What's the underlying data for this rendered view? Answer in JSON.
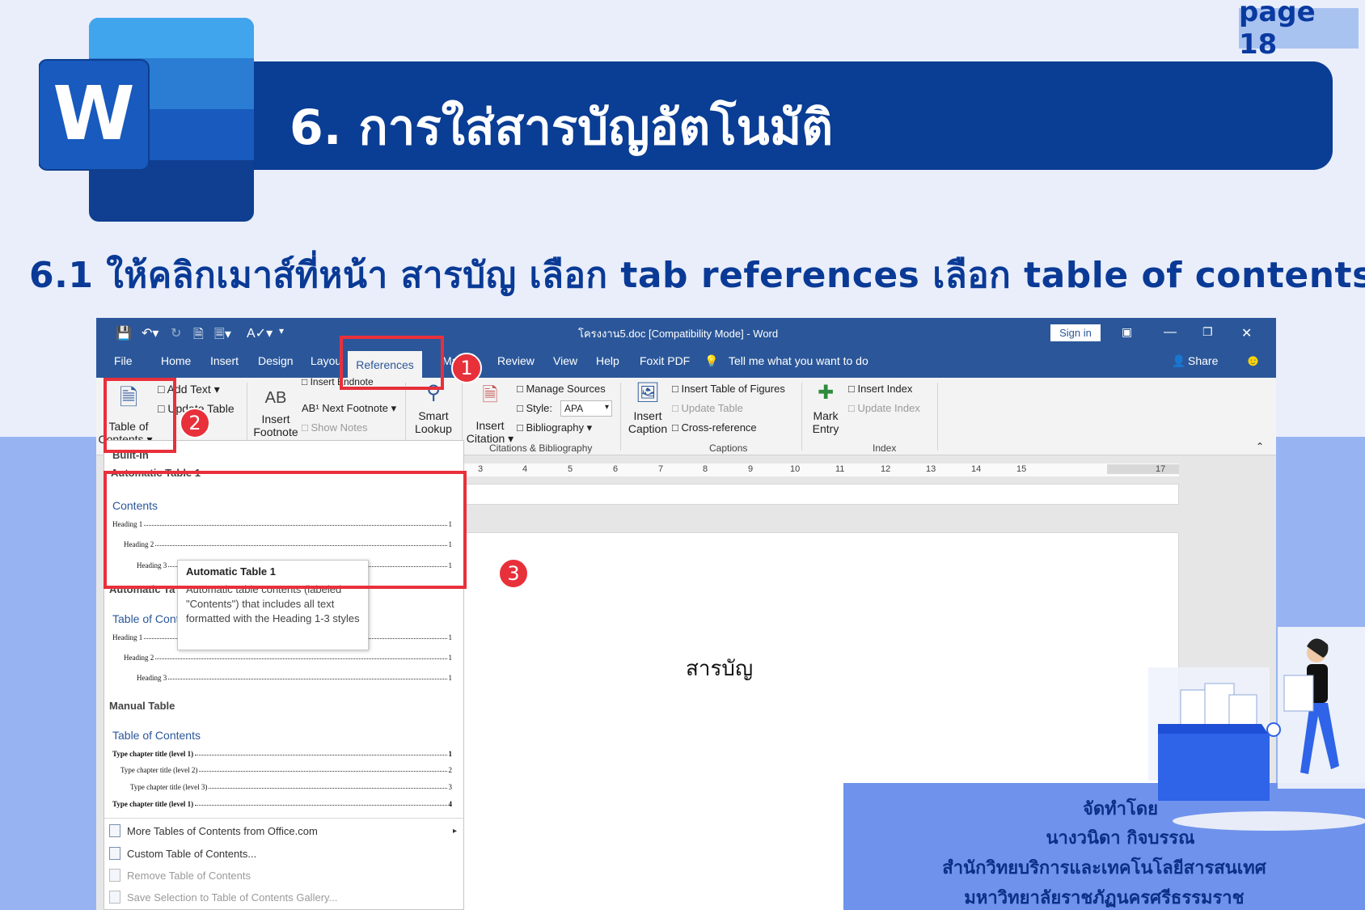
{
  "slide": {
    "page_tag": "page 18",
    "title": "6.   การใส่สารบัญอัตโนมัติ",
    "subtitle": "6.1 ให้คลิกเมาส์ที่หน้า สารบัญ เลือก tab references เลือก table of contents",
    "credit": {
      "line1": "จัดทำโดย",
      "line2": "นางวนิดา กิจบรรณ",
      "line3": "สำนักวิทยบริการและเทคโนโลยีสารสนเทศ",
      "line4": "มหาวิทยาลัยราชภัฏนครศรีธรรมราช"
    },
    "logo_letter": "W"
  },
  "word": {
    "window_title": "โครงงาน5.doc [Compatibility Mode]  -  Word",
    "sign_in": "Sign in",
    "tabs": [
      "File",
      "Home",
      "Insert",
      "Design",
      "Layou",
      "References",
      "Ma",
      "Review",
      "View",
      "Help",
      "Foxit PDF"
    ],
    "active_tab": "References",
    "tell_me": "Tell me what you want to do",
    "share": "Share",
    "ribbon": {
      "toc_button": "Table of",
      "toc_button2": "Contents",
      "add_text": "Add Text",
      "update_table": "Update Table",
      "insert_endnote": "Insert Endnote",
      "insert_footnote": "Insert",
      "insert_footnote2": "Footnote",
      "ab_label": "AB",
      "next_footnote": "Next Footnote",
      "show_notes": "Show Notes",
      "smart_lookup": "Smart",
      "smart_lookup2": "Lookup",
      "research": "arch",
      "insert_citation": "Insert",
      "insert_citation2": "Citation",
      "manage_sources": "Manage Sources",
      "style_label": "Style:",
      "style_value": "APA",
      "bibliography": "Bibliography",
      "group_citations": "Citations & Bibliography",
      "insert_caption": "Insert",
      "insert_caption2": "Caption",
      "insert_table_figures": "Insert Table of Figures",
      "update_table2": "Update Table",
      "cross_reference": "Cross-reference",
      "group_captions": "Captions",
      "mark_entry": "Mark",
      "mark_entry2": "Entry",
      "insert_index": "Insert Index",
      "update_index": "Update Index",
      "group_index": "Index"
    },
    "ruler_ticks": [
      "3",
      "4",
      "5",
      "6",
      "7",
      "8",
      "9",
      "10",
      "11",
      "12",
      "13",
      "14",
      "15",
      "17"
    ],
    "document_text": "สารบัญ"
  },
  "dropdown": {
    "builtin": "Built-In",
    "auto1_header": "Automatic Table 1",
    "auto1_title": "Contents",
    "heading1": "Heading 1",
    "heading2": "Heading 2",
    "heading3": "Heading 3",
    "page_no": "1",
    "auto2_header": "Automatic Ta",
    "auto2_title": "Table of Cont",
    "manual_header": "Manual Table",
    "manual_title": "Table of Contents",
    "manual_l1": "Type chapter title (level 1)",
    "manual_l2": "Type chapter title (level 2)",
    "manual_l3": "Type chapter title (level 3)",
    "manual_l1b": "Type chapter title (level 1)",
    "manual_p1": "1",
    "manual_p2": "2",
    "manual_p3": "3",
    "manual_p4": "4",
    "more_tables": "More Tables of Contents from Office.com",
    "custom_toc": "Custom Table of Contents...",
    "remove_toc": "Remove Table of Contents",
    "save_selection": "Save Selection to Table of Contents Gallery...",
    "tooltip_title": "Automatic Table 1",
    "tooltip_body": "Automatic table contents (labeled \"Contents\") that includes all text formatted with the Heading 1-3 styles"
  },
  "annotations": {
    "step1": "1",
    "step2": "2",
    "step3": "3",
    "color": "#e8303b"
  },
  "colors": {
    "word_blue": "#2b579a",
    "title_bar": "#0a3d94",
    "band": "#97b3f2",
    "credit_bg": "#6f93ec"
  }
}
